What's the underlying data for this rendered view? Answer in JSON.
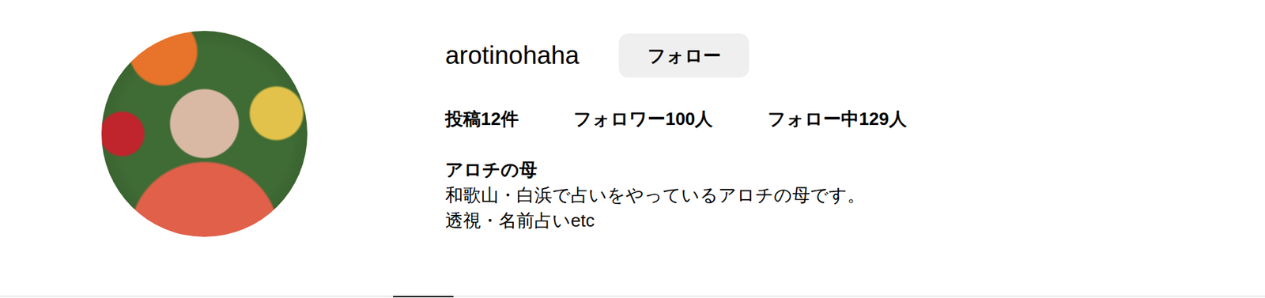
{
  "profile": {
    "username": "arotinohaha",
    "follow_button": "フォロー",
    "stats": [
      "投稿12件",
      "フォロワー100人",
      "フォロー中129人"
    ],
    "name": "アロチの母",
    "bio": [
      "和歌山・白浜で占いをやっているアロチの母です。",
      "透視・名前占いetc"
    ]
  },
  "tab_strip": {
    "tabs": [
      {
        "selected": true
      }
    ]
  }
}
